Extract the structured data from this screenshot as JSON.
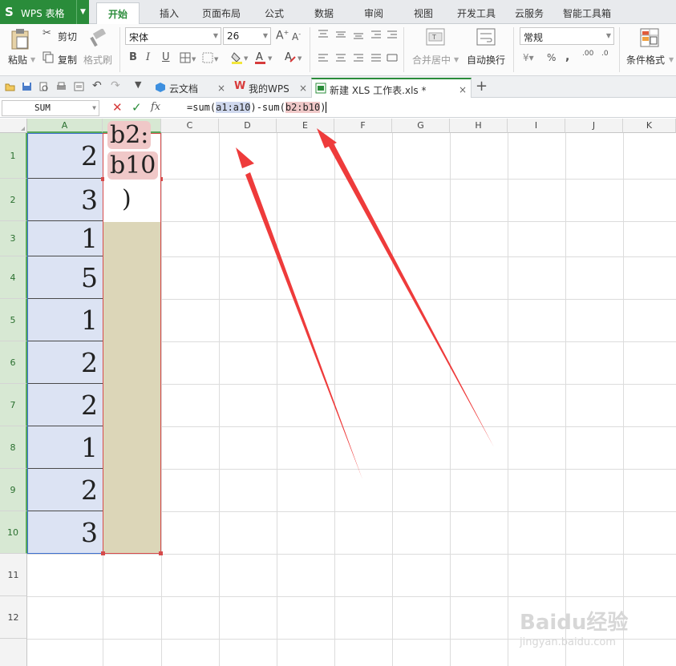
{
  "app": {
    "logo": "S",
    "name": "WPS 表格"
  },
  "menu": {
    "tabs": [
      "开始",
      "插入",
      "页面布局",
      "公式",
      "数据",
      "审阅",
      "视图",
      "开发工具",
      "云服务",
      "智能工具箱"
    ],
    "active": "开始"
  },
  "ribbon": {
    "paste": "粘贴",
    "cut": "剪切",
    "copy": "复制",
    "format_painter": "格式刷",
    "font_name": "宋体",
    "font_size": "26",
    "merge_center": "合并居中",
    "wrap_text": "自动换行",
    "number_format": "常规",
    "conditional_format": "条件格式",
    "bold": "B",
    "italic": "I",
    "underline": "U",
    "percent": "%",
    "comma": ",",
    "dec_inc": ".00",
    "dec_dec": ".0"
  },
  "doc_tabs": [
    {
      "label": "云文档"
    },
    {
      "label": "我的WPS"
    },
    {
      "label": "新建 XLS 工作表.xls *"
    }
  ],
  "formula_bar": {
    "name_box": "SUM",
    "fx": "fx",
    "parts": [
      "=sum(",
      "a1:a10",
      ")-sum(",
      "b2:b10",
      ")"
    ]
  },
  "grid": {
    "columns": [
      "A",
      "B",
      "C",
      "D",
      "E",
      "F",
      "G",
      "H",
      "I",
      "J",
      "K"
    ],
    "rows": [
      "1",
      "2",
      "3",
      "4",
      "5",
      "6",
      "7",
      "8",
      "9",
      "10",
      "11",
      "12"
    ],
    "col_a_values": [
      "2",
      "3",
      "1",
      "5",
      "1",
      "2",
      "2",
      "1",
      "2",
      "3"
    ],
    "edit_text": {
      "line1": "b2:",
      "line2": "b10",
      "line3": ")"
    }
  },
  "watermark": {
    "brand": "Baidu经验",
    "url": "jingyan.baidu.com"
  },
  "colors": {
    "brand_green": "#2a8c3a",
    "range_a": "#dce3f3",
    "range_b": "#dcd6b8",
    "arrow_red": "#ee3b3b"
  }
}
